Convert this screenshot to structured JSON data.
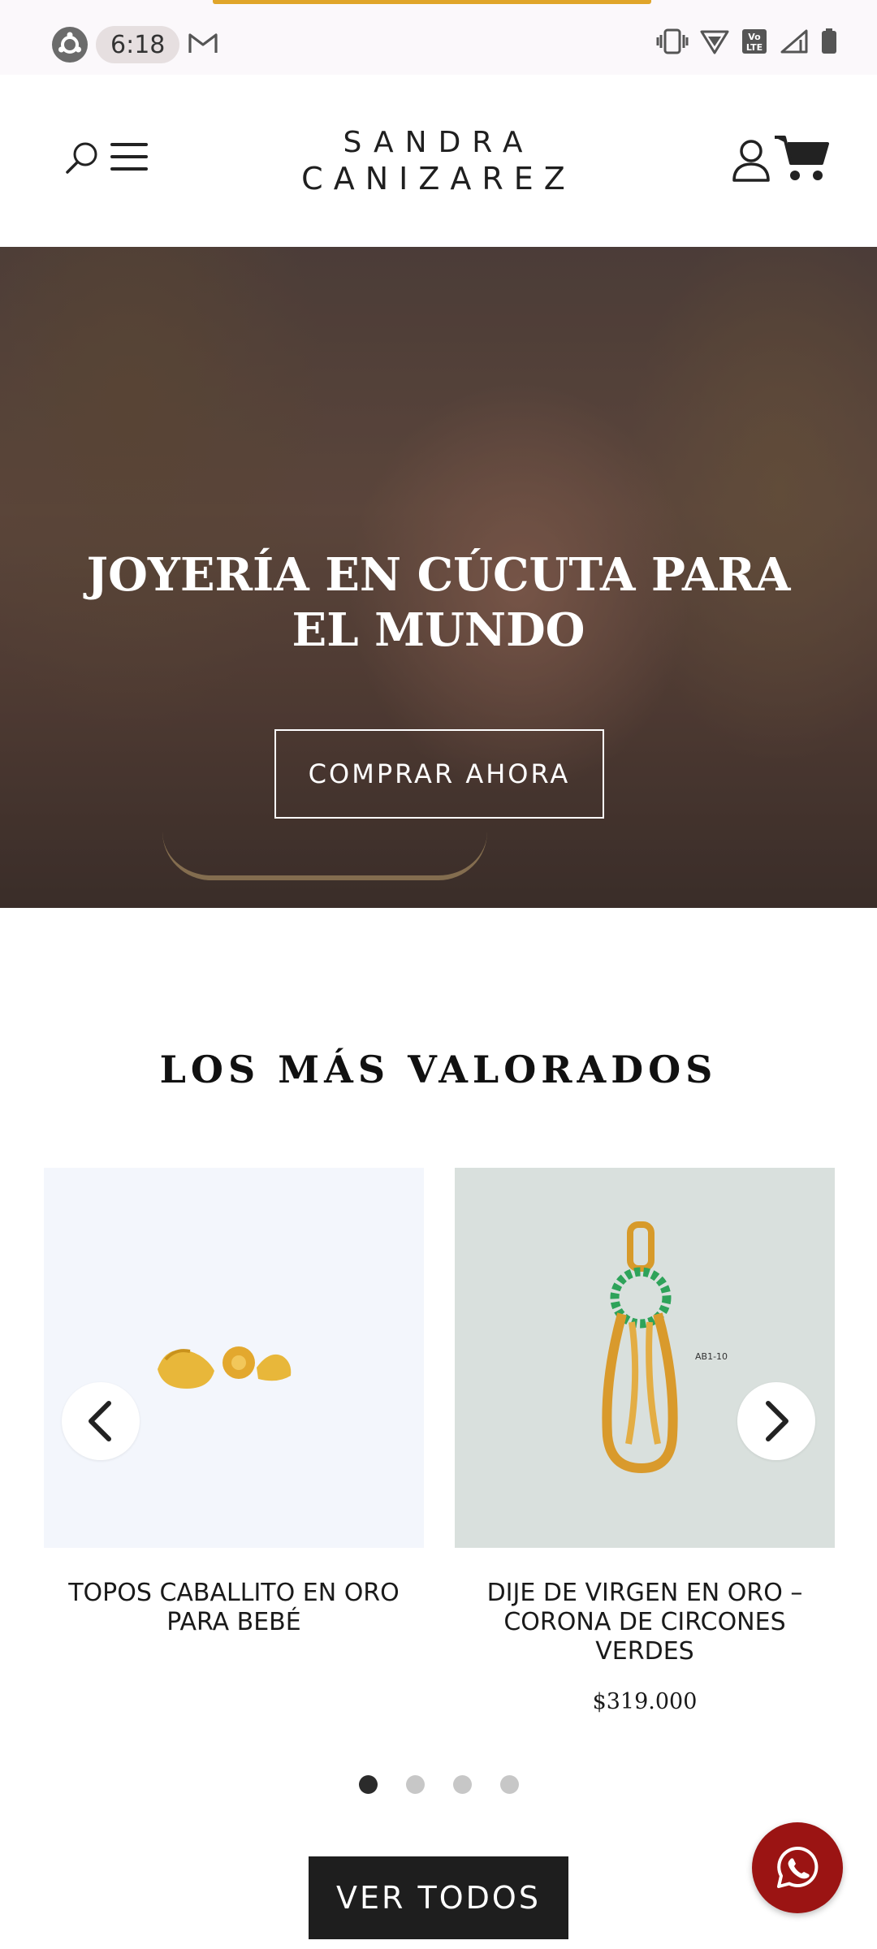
{
  "status_bar": {
    "time": "6:18",
    "icons": [
      "ubuntu-icon",
      "gmail-icon",
      "vibrate-icon",
      "wifi-icon",
      "volte-icon",
      "signal-icon",
      "battery-icon"
    ],
    "accent_color": "#e0a52a"
  },
  "header": {
    "logo_line1": "SANDRA",
    "logo_line2": "CANIZAREZ",
    "icons": [
      "search-icon",
      "menu-icon",
      "user-icon",
      "cart-icon"
    ]
  },
  "hero": {
    "title": "JOYERÍA EN CÚCUTA PARA EL MUNDO",
    "button_label": "COMPRAR AHORA"
  },
  "featured": {
    "title": "LOS MÁS VALORADOS",
    "products": [
      {
        "name": "TOPOS CABALLITO EN ORO PARA BEBÉ",
        "price": ""
      },
      {
        "name": "DIJE DE VIRGEN EN ORO – CORONA DE CIRCONES VERDES",
        "price": "$319.000",
        "tag": "AB1-10"
      }
    ],
    "pagination": {
      "total": 4,
      "current": 1
    },
    "view_all_label": "VER TODOS"
  },
  "whatsapp": {
    "icon": "whatsapp-icon",
    "color": "#9b1413"
  }
}
